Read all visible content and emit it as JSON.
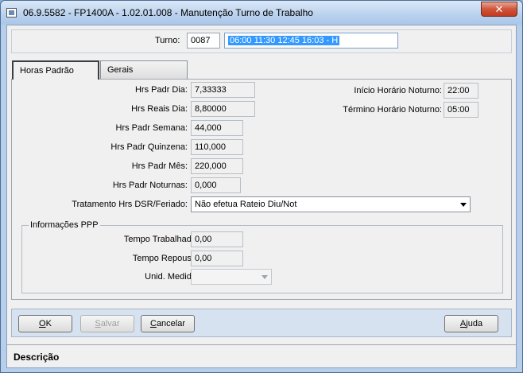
{
  "window": {
    "title": "06.9.5582 - FP1400A - 1.02.01.008 - Manutenção Turno de Trabalho",
    "close_label": "✕"
  },
  "turno": {
    "label": "Turno:",
    "code": "0087",
    "description": "06:00 11:30 12:45 16:03 -  H"
  },
  "tabs": [
    {
      "label": "Horas Padrão",
      "active": true
    },
    {
      "label": "Gerais",
      "active": false
    }
  ],
  "horas": {
    "hrs_padr_dia": {
      "label": "Hrs Padr Dia:",
      "value": "7,33333"
    },
    "hrs_reais_dia": {
      "label": "Hrs Reais Dia:",
      "value": "8,80000"
    },
    "hrs_padr_semana": {
      "label": "Hrs Padr Semana:",
      "value": "44,000"
    },
    "hrs_padr_quinzena": {
      "label": "Hrs Padr Quinzena:",
      "value": "110,000"
    },
    "hrs_padr_mes": {
      "label": "Hrs Padr Mês:",
      "value": "220,000"
    },
    "hrs_padr_noturnas": {
      "label": "Hrs Padr Noturnas:",
      "value": "0,000"
    },
    "inicio_noturno": {
      "label": "Início Horário Noturno:",
      "value": "22:00"
    },
    "termino_noturno": {
      "label": "Término Horário Noturno:",
      "value": "05:00"
    },
    "tratamento": {
      "label": "Tratamento Hrs DSR/Feriado:",
      "value": "Não efetua Rateio Diu/Not"
    }
  },
  "ppp": {
    "title": "Informações PPP",
    "tempo_trabalhado": {
      "label": "Tempo Trabalhado:",
      "value": "0,00"
    },
    "tempo_repouso": {
      "label": "Tempo Repouso:",
      "value": "0,00"
    },
    "unid_medida": {
      "label": "Unid. Medida:",
      "value": ""
    }
  },
  "buttons": {
    "ok": {
      "first": "O",
      "rest": "K"
    },
    "salvar": {
      "first": "S",
      "rest": "alvar"
    },
    "cancelar": {
      "first": "C",
      "rest": "ancelar"
    },
    "ajuda": {
      "first": "A",
      "rest": "juda"
    }
  },
  "description_bar": {
    "label": "Descrição"
  }
}
